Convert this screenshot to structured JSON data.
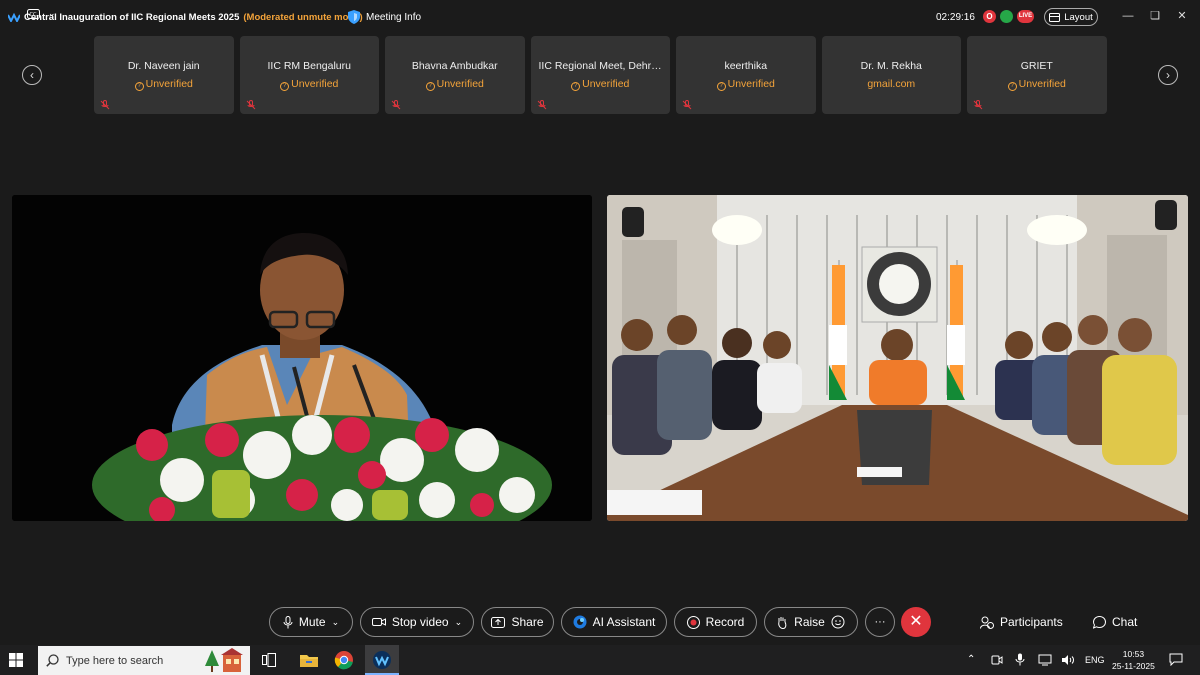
{
  "titlebar": {
    "title": "Central Inauguration of IIC Regional Meets 2025",
    "mode": "(Moderated unmute mode)",
    "meeting_info": "Meeting Info",
    "timer": "02:29:16",
    "badge_o": "O",
    "badge_live": "LIVE",
    "layout": "Layout"
  },
  "participants": [
    {
      "name": "Dr. Naveen jain",
      "status": "Unverified",
      "verified_icon": true
    },
    {
      "name": "IIC RM Bengaluru",
      "status": "Unverified",
      "verified_icon": true
    },
    {
      "name": "Bhavna Ambudkar",
      "status": "Unverified",
      "verified_icon": true
    },
    {
      "name": "IIC Regional Meet, Dehra...",
      "status": "Unverified",
      "verified_icon": true
    },
    {
      "name": "keerthika",
      "status": "Unverified",
      "verified_icon": true
    },
    {
      "name": "Dr. M. Rekha",
      "status": "gmail.com",
      "verified_icon": false
    },
    {
      "name": "GRIET",
      "status": "Unverified",
      "verified_icon": true
    }
  ],
  "controls": {
    "mute": "Mute",
    "stop_video": "Stop video",
    "share": "Share",
    "ai_assistant": "AI Assistant",
    "record": "Record",
    "raise": "Raise",
    "more": "···",
    "participants": "Participants",
    "chat": "Chat"
  },
  "taskbar": {
    "search_placeholder": "Type here to search",
    "lang": "ENG",
    "time": "10:53",
    "date": "25-11-2025"
  },
  "colors": {
    "accent_orange": "#f3a33a",
    "leave_red": "#e0353d",
    "bg": "#1b1b1b",
    "tile": "#333333"
  }
}
